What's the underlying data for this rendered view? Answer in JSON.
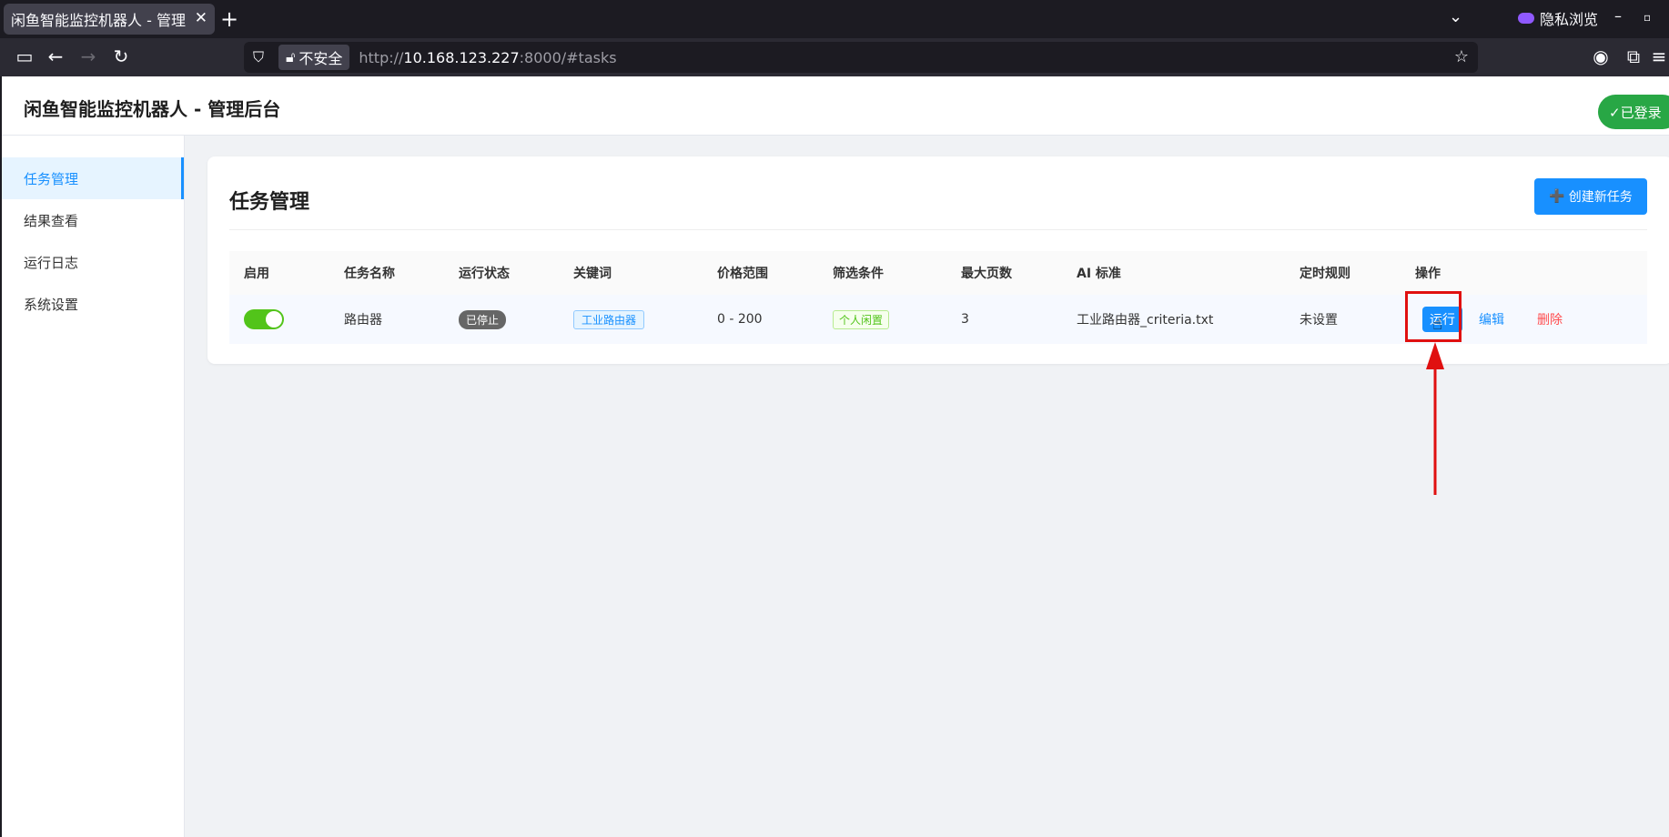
{
  "browser": {
    "tab_title": "闲鱼智能监控机器人 - 管理后",
    "private_label": "隐私浏览",
    "insecure_label": "不安全",
    "url_prefix": "http://",
    "url_host": "10.168.123.227",
    "url_suffix": ":8000/#tasks"
  },
  "header": {
    "title": "闲鱼智能监控机器人 - 管理后台",
    "login_status": "✓已登录"
  },
  "sidebar": {
    "items": [
      {
        "label": "任务管理"
      },
      {
        "label": "结果查看"
      },
      {
        "label": "运行日志"
      },
      {
        "label": "系统设置"
      }
    ]
  },
  "main": {
    "title": "任务管理",
    "create_button": "创建新任务",
    "columns": [
      "启用",
      "任务名称",
      "运行状态",
      "关键词",
      "价格范围",
      "筛选条件",
      "最大页数",
      "AI 标准",
      "定时规则",
      "操作"
    ],
    "rows": [
      {
        "enabled": true,
        "name": "路由器",
        "status": "已停止",
        "keyword": "工业路由器",
        "price_range": "0 - 200",
        "filter": "个人闲置",
        "max_pages": "3",
        "ai_criteria": "工业路由器_criteria.txt",
        "schedule": "未设置",
        "actions": {
          "run": "运行",
          "edit": "编辑",
          "delete": "删除"
        }
      }
    ]
  },
  "colors": {
    "accent": "#1890ff",
    "success": "#28a745",
    "danger": "#ff4d4f",
    "highlight": "#e01010"
  }
}
